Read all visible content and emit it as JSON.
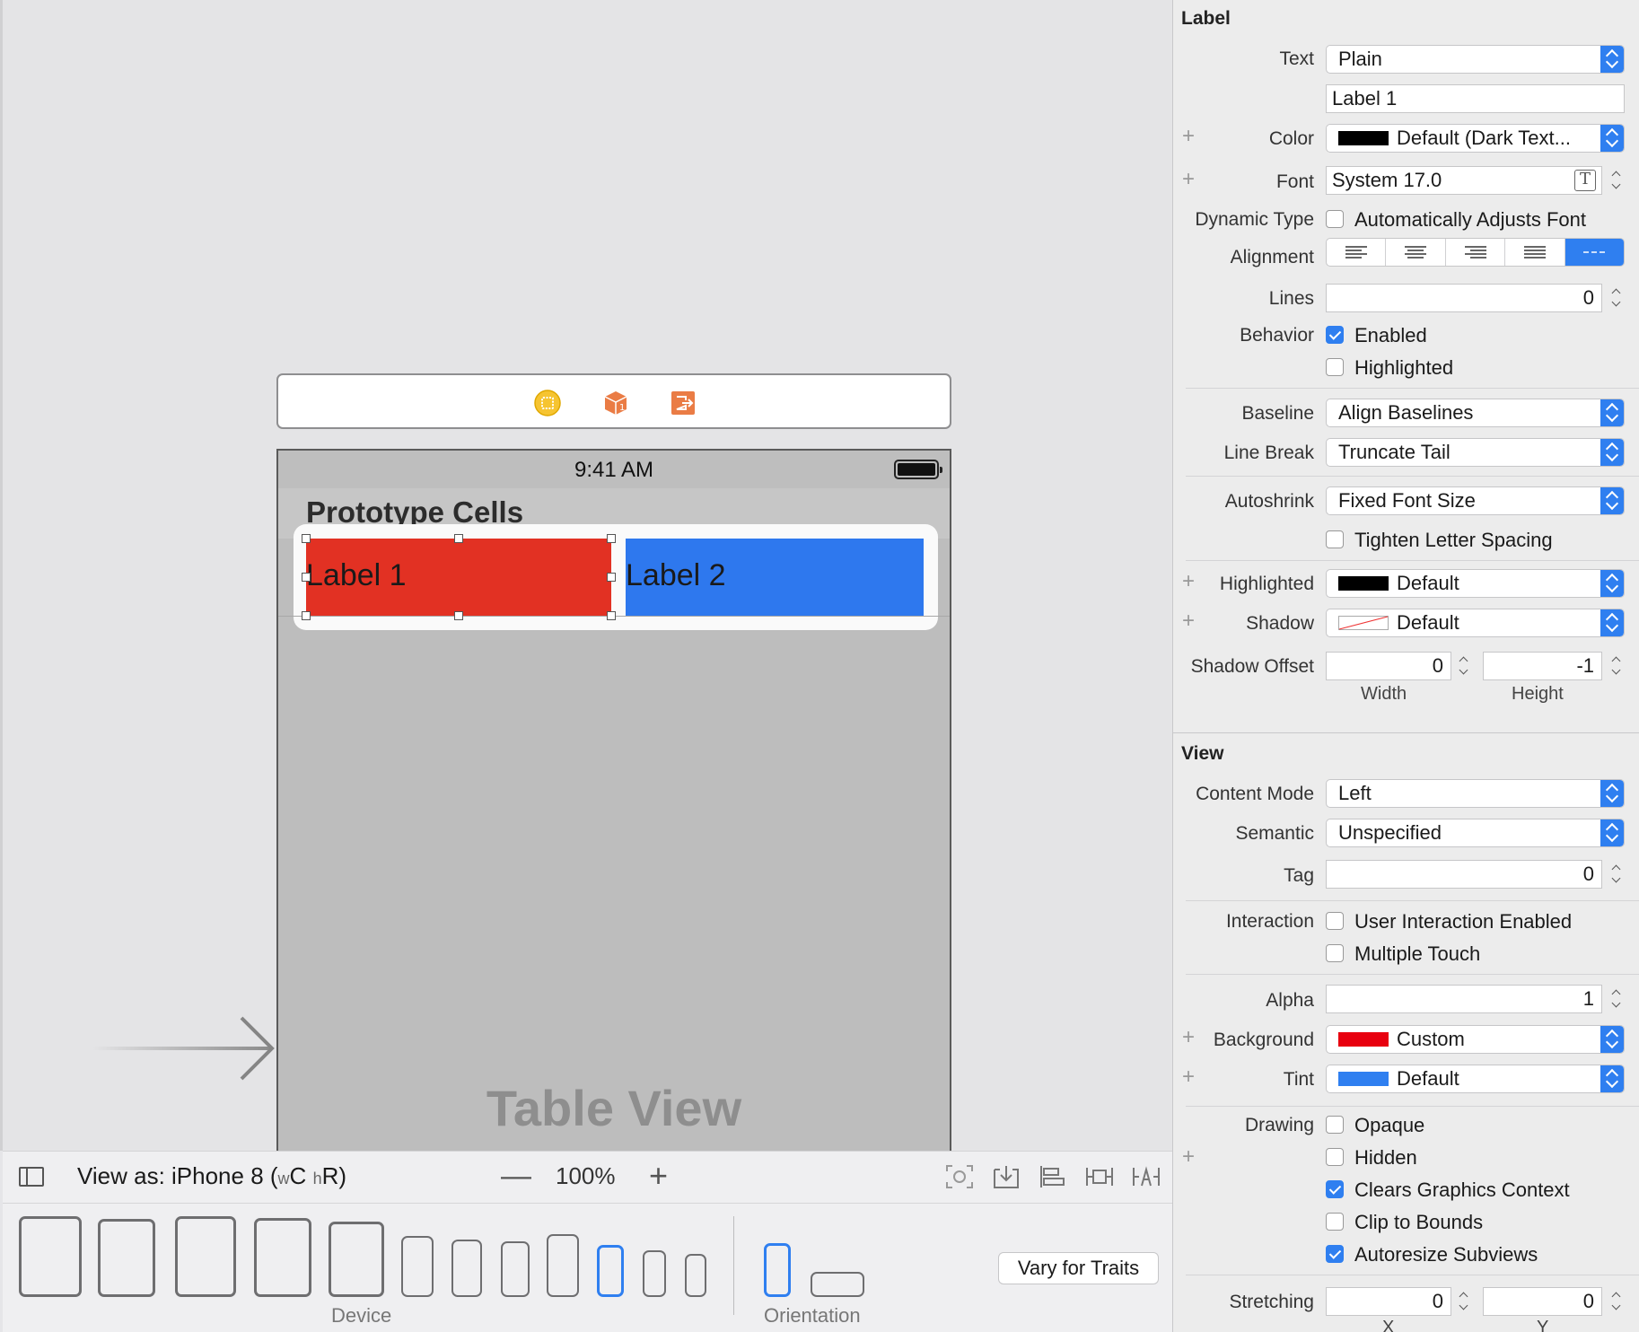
{
  "canvas": {
    "status_time": "9:41 AM",
    "table_header_title": "Prototype Cells",
    "label1_text": "Label 1",
    "label2_text": "Label 2",
    "table_view_watermark": "Table View"
  },
  "bottom_bar": {
    "view_as_prefix": "View as: iPhone 8 (",
    "w_small": "w",
    "w_class": "C",
    "h_small": "h",
    "h_class": "R)",
    "zoom_out": "—",
    "zoom_level": "100%",
    "zoom_in": "+"
  },
  "device_bar": {
    "device_caption": "Device",
    "orientation_caption": "Orientation",
    "vary_button": "Vary for Traits"
  },
  "inspector": {
    "label_section": "Label",
    "text": {
      "label": "Text",
      "value": "Plain",
      "content": "Label 1"
    },
    "color": {
      "label": "Color",
      "value": "Default (Dark Text...",
      "swatch": "#000000"
    },
    "font": {
      "label": "Font",
      "value": "System 17.0",
      "icon": "T"
    },
    "dynamic_type": {
      "label": "Dynamic Type",
      "option": "Automatically Adjusts Font",
      "checked": false
    },
    "alignment": {
      "label": "Alignment"
    },
    "lines": {
      "label": "Lines",
      "value": "0"
    },
    "behavior": {
      "label": "Behavior",
      "enabled": "Enabled",
      "enabled_checked": true,
      "highlighted": "Highlighted",
      "highlighted_checked": false
    },
    "baseline": {
      "label": "Baseline",
      "value": "Align Baselines"
    },
    "line_break": {
      "label": "Line Break",
      "value": "Truncate Tail"
    },
    "autoshrink": {
      "label": "Autoshrink",
      "value": "Fixed Font Size",
      "tighten": "Tighten Letter Spacing",
      "tighten_checked": false
    },
    "highlighted": {
      "label": "Highlighted",
      "value": "Default",
      "swatch": "#000000"
    },
    "shadow": {
      "label": "Shadow",
      "value": "Default"
    },
    "shadow_offset": {
      "label": "Shadow Offset",
      "width": "0",
      "height": "-1",
      "width_caption": "Width",
      "height_caption": "Height"
    },
    "view_section": "View",
    "content_mode": {
      "label": "Content Mode",
      "value": "Left"
    },
    "semantic": {
      "label": "Semantic",
      "value": "Unspecified"
    },
    "tag": {
      "label": "Tag",
      "value": "0"
    },
    "interaction": {
      "label": "Interaction",
      "user_interaction": "User Interaction Enabled",
      "multiple_touch": "Multiple Touch"
    },
    "alpha": {
      "label": "Alpha",
      "value": "1"
    },
    "background": {
      "label": "Background",
      "value": "Custom",
      "swatch": "#e8000f"
    },
    "tint": {
      "label": "Tint",
      "value": "Default",
      "swatch": "#2f7ff0"
    },
    "drawing": {
      "label": "Drawing",
      "opaque": "Opaque",
      "hidden": "Hidden",
      "clears": "Clears Graphics Context",
      "clip": "Clip to Bounds",
      "autoresize": "Autoresize Subviews"
    },
    "stretching": {
      "label": "Stretching",
      "x": "0",
      "y": "0",
      "x_caption": "X",
      "y_caption": "Y"
    }
  }
}
